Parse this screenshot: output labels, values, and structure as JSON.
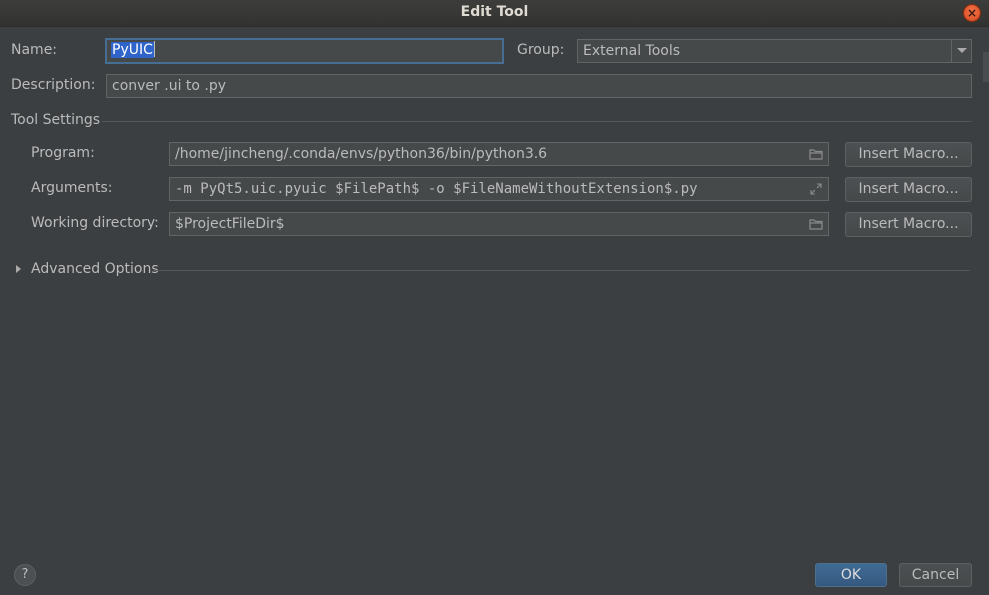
{
  "window": {
    "title": "Edit Tool",
    "close_glyph": "×"
  },
  "form": {
    "name_label": "Name:",
    "name_value": "PyUIC",
    "group_label": "Group:",
    "group_value": "External Tools",
    "description_label": "Description:",
    "description_value": "conver .ui to .py"
  },
  "tool_settings": {
    "section_title": "Tool Settings",
    "program_label": "Program:",
    "program_value": "/home/jincheng/.conda/envs/python36/bin/python3.6",
    "arguments_label": "Arguments:",
    "arguments_value": "-m PyQt5.uic.pyuic $FilePath$ -o $FileNameWithoutExtension$.py",
    "working_dir_label": "Working directory:",
    "working_dir_value": "$ProjectFileDir$",
    "insert_macro_label": "Insert Macro..."
  },
  "advanced": {
    "label": "Advanced Options"
  },
  "footer": {
    "help_glyph": "?",
    "ok_label": "OK",
    "cancel_label": "Cancel"
  },
  "colors": {
    "background": "#3c3f41",
    "field_bg": "#45494a",
    "accent_selection": "#2f65ca",
    "focus_border": "#466d94",
    "primary_button": "#365880",
    "close_button": "#e5562b"
  },
  "icons": {
    "close": "close-icon",
    "folder": "folder-icon",
    "expand": "expand-icon",
    "chevron": "chevron-right-icon",
    "dropdown": "chevron-down-icon",
    "help": "help-icon"
  }
}
